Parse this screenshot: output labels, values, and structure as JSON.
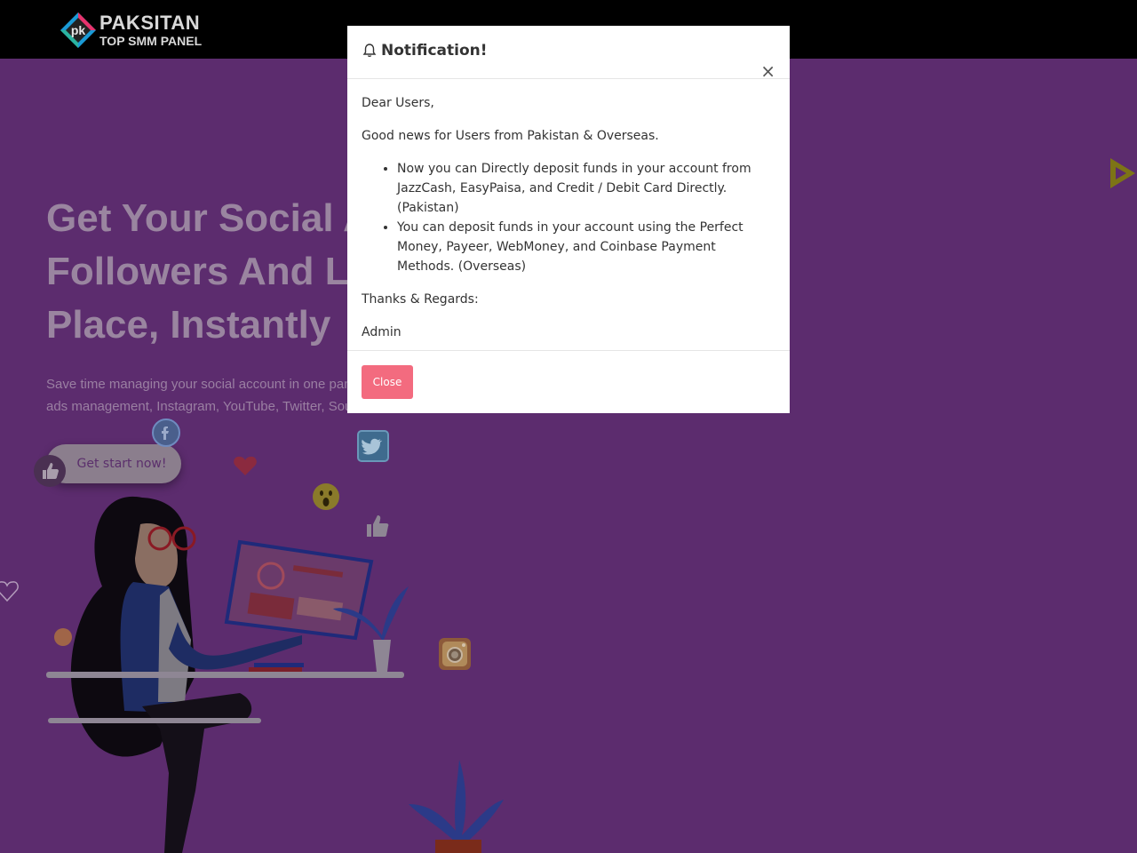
{
  "brand": {
    "logo_letters": "pk",
    "line1": "PAKSITAN",
    "line2": "TOP SMM PANEL"
  },
  "hero": {
    "title_lines": [
      "Get Your Social A",
      "Followers And Li",
      "Place, Instantly"
    ],
    "subtitle_line1": "Save time managing your social account in one panel.",
    "subtitle_line2": "ads management, Instagram, YouTube, Twitter, Sound",
    "cta_label": "Get start now!"
  },
  "modal": {
    "title": "Notification!",
    "close_symbol": "×",
    "greeting": "Dear Users,",
    "intro": "Good news for Users from Pakistan & Overseas.",
    "bullets": [
      "Now you can Directly deposit funds in your account from JazzCash, EasyPaisa, and Credit / Debit Card Directly. (Pakistan)",
      "You can deposit funds in your account using the Perfect Money, Payeer, WebMoney, and Coinbase Payment Methods. (Overseas)"
    ],
    "regards": "Thanks & Regards:",
    "signature": "Admin",
    "close_button": "Close"
  },
  "colors": {
    "background": "#5c2c6e",
    "topbar": "#000000",
    "close_button": "#f36b7f",
    "hero_title": "#9a85a0"
  },
  "icons": [
    "bell-icon",
    "facebook-icon",
    "twitter-icon",
    "instagram-icon",
    "heart-icon",
    "thumbs-up-icon",
    "wow-emoji-icon",
    "play-icon"
  ]
}
